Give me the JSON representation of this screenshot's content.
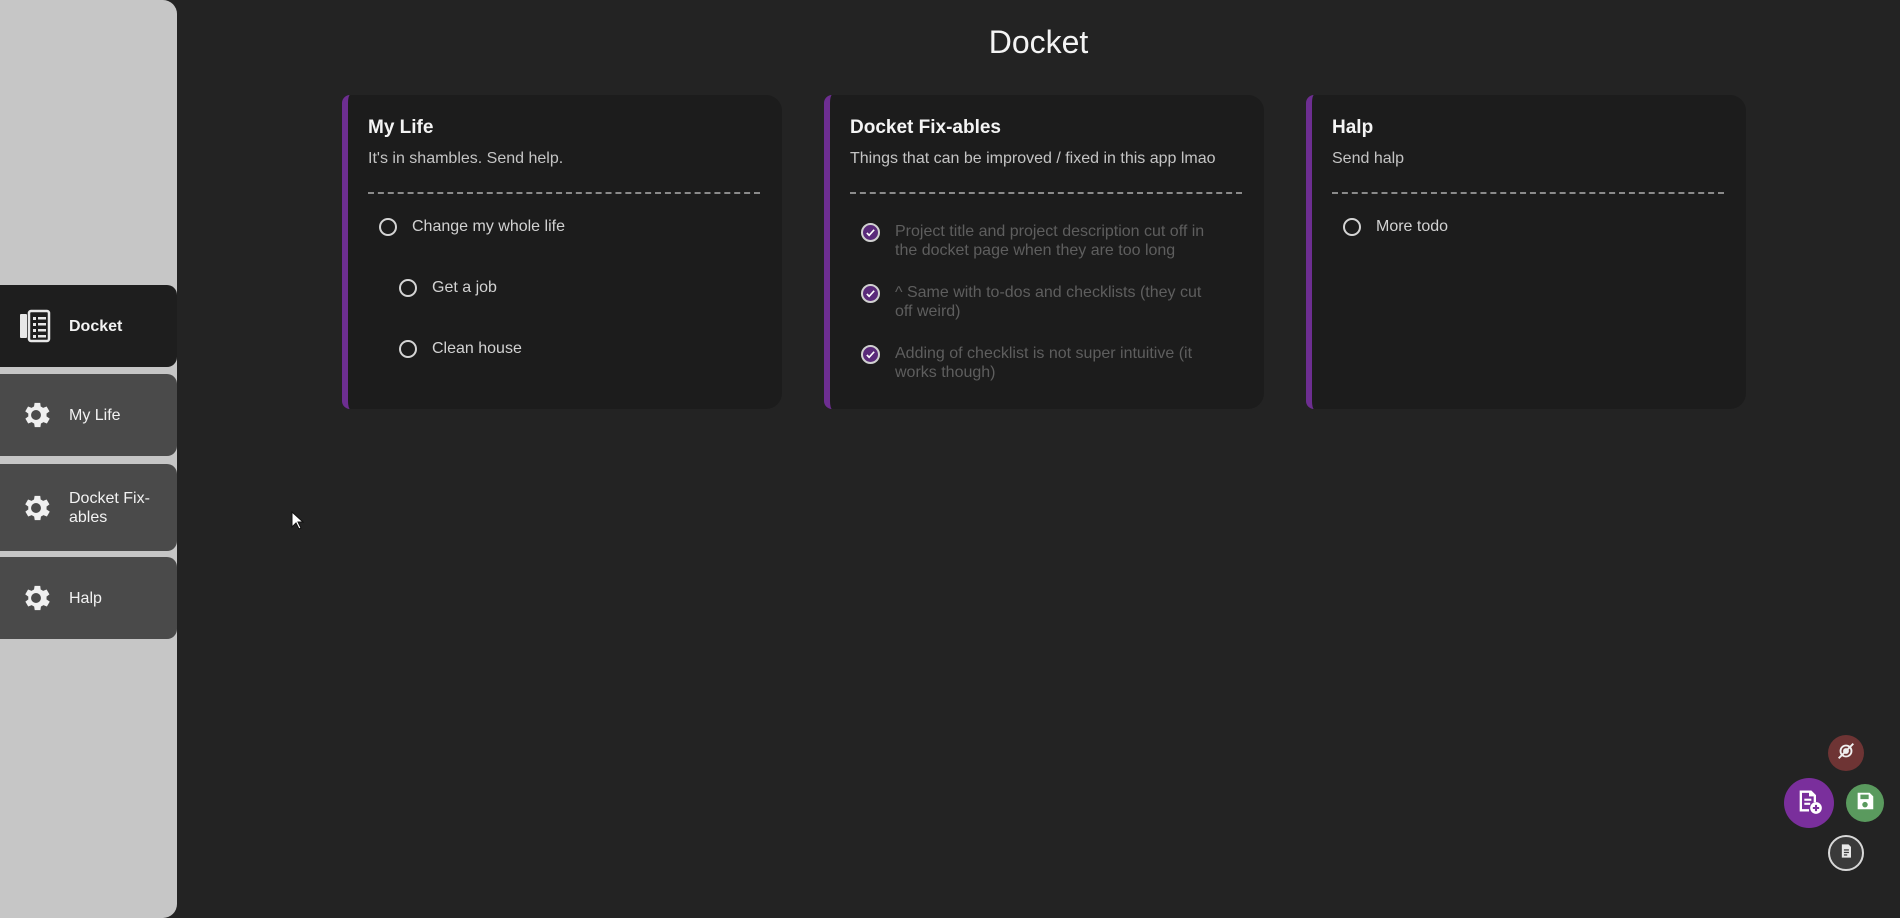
{
  "title": "Docket",
  "sidebar": {
    "items": [
      {
        "label": "Docket",
        "icon": "docket-icon",
        "active": true
      },
      {
        "label": "My Life",
        "icon": "gear-icon"
      },
      {
        "label": "Docket Fix-ables",
        "icon": "gear-icon"
      },
      {
        "label": "Halp",
        "icon": "gear-icon"
      }
    ]
  },
  "projects": [
    {
      "title": "My Life",
      "description": "It's in shambles. Send help.",
      "todos": [
        {
          "text": "Change my whole life",
          "done": false
        },
        {
          "text": "Get a job",
          "done": false,
          "sub": true
        },
        {
          "text": "Clean house",
          "done": false,
          "sub": true
        }
      ]
    },
    {
      "title": "Docket Fix-ables",
      "description": "Things that can be improved / fixed in this app lmao",
      "todos": [
        {
          "text": "Project title and project description cut off in the docket page when they are too long",
          "done": true
        },
        {
          "text": "^ Same with to-dos and checklists (they cut off weird)",
          "done": true
        },
        {
          "text": "Adding of checklist is not super intuitive (it works though)",
          "done": true
        }
      ]
    },
    {
      "title": "Halp",
      "description": "Send halp",
      "todos": [
        {
          "text": "More todo",
          "done": false
        }
      ]
    }
  ],
  "fab": {
    "colors": {
      "accent": "#7a2f9c",
      "save": "#5a9a5e",
      "danger": "#7a3a3a",
      "neutral": "#3a3a3a"
    },
    "icons": [
      "settings-off-icon",
      "add-project-icon",
      "save-icon",
      "sync-icon"
    ]
  }
}
